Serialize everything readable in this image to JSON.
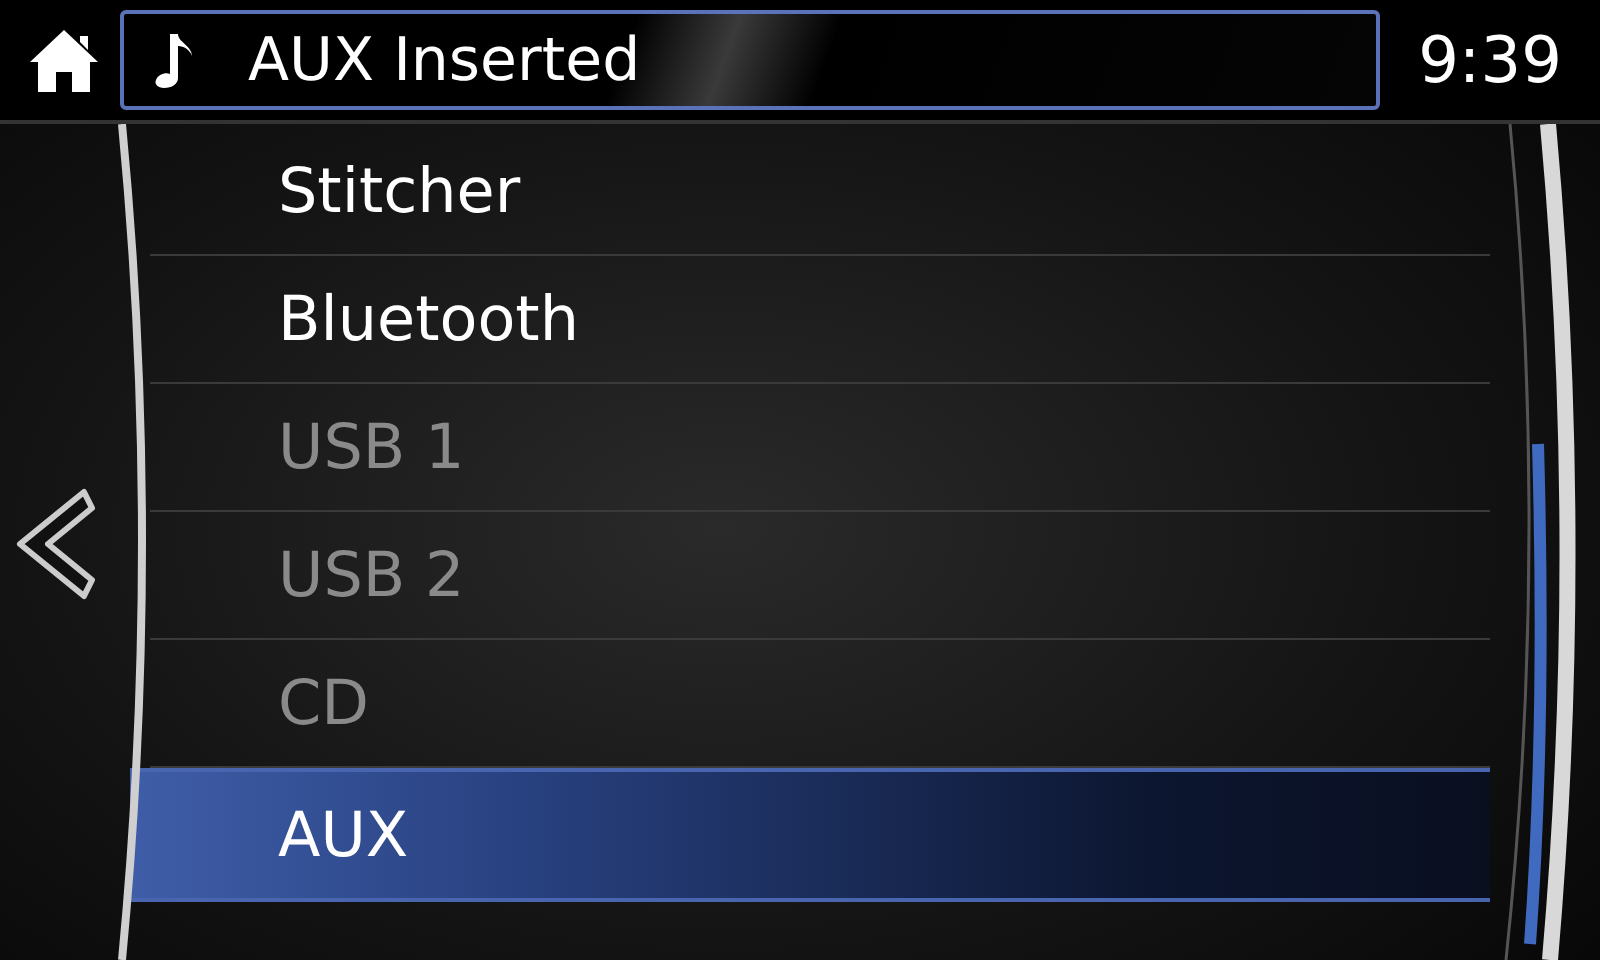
{
  "header": {
    "title": "AUX Inserted",
    "time": "9:39"
  },
  "sources": [
    {
      "label": "Stitcher",
      "disabled": false,
      "selected": false
    },
    {
      "label": "Bluetooth",
      "disabled": false,
      "selected": false
    },
    {
      "label": "USB 1",
      "disabled": true,
      "selected": false
    },
    {
      "label": "USB 2",
      "disabled": true,
      "selected": false
    },
    {
      "label": "CD",
      "disabled": true,
      "selected": false
    },
    {
      "label": "AUX",
      "disabled": false,
      "selected": true
    }
  ]
}
